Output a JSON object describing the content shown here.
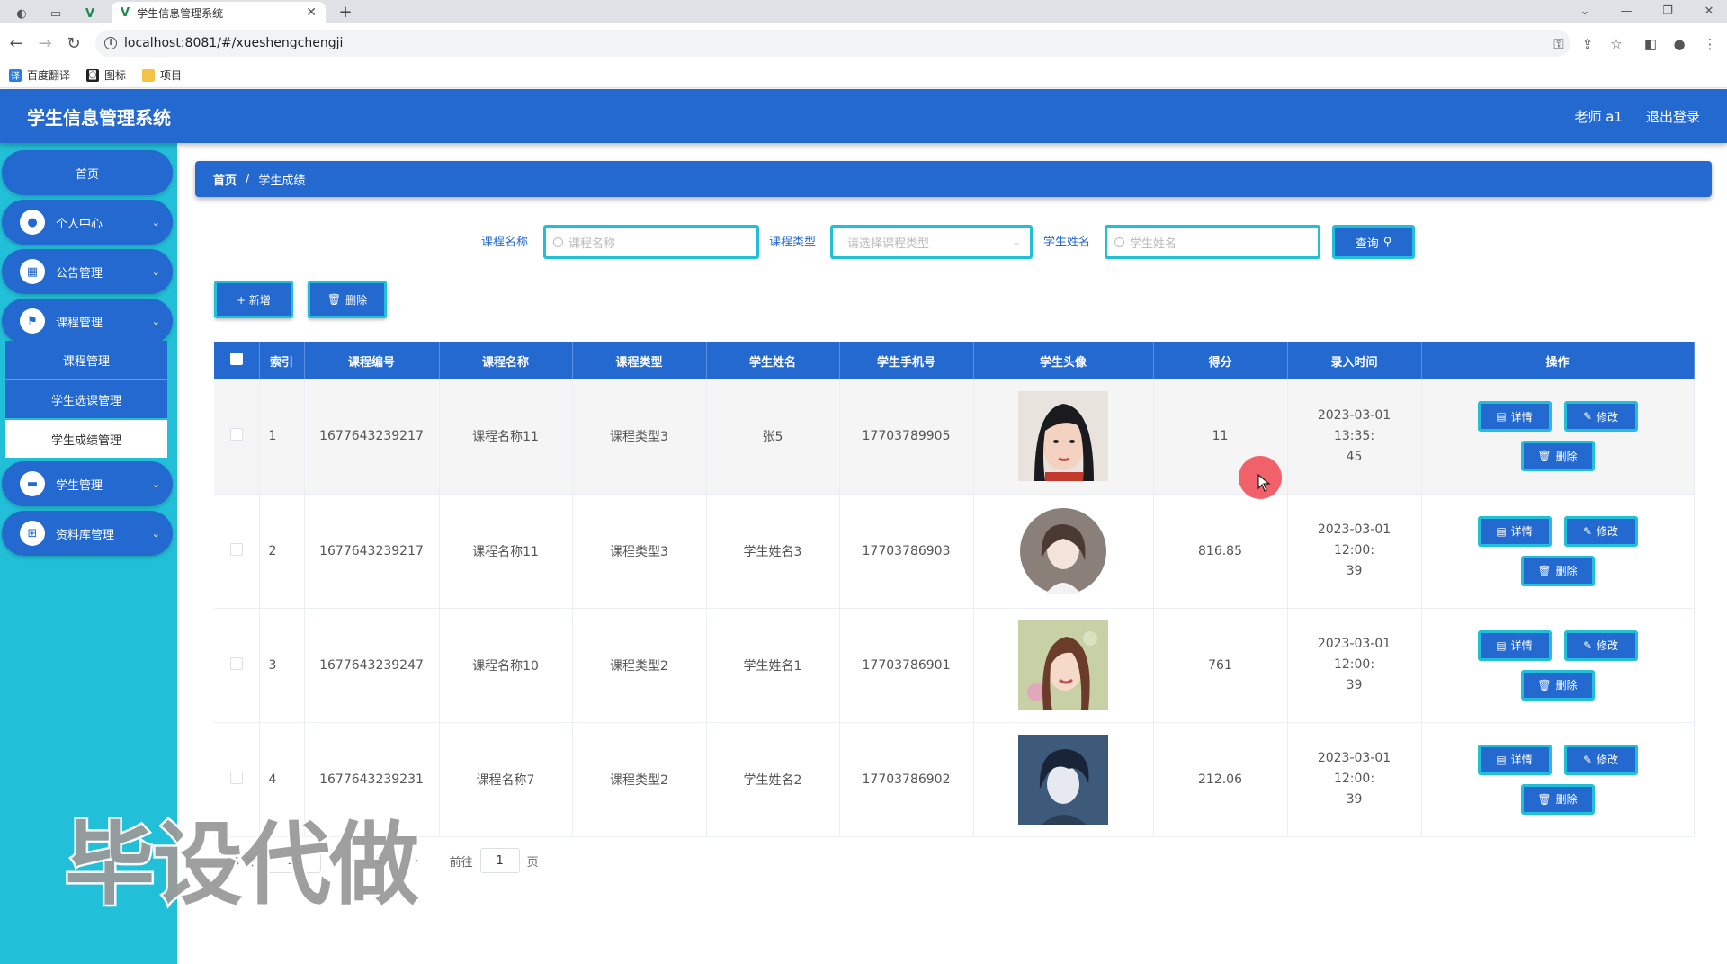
{
  "browser": {
    "tab_title": "学生信息管理系统",
    "url": "localhost:8081/#/xueshengchengji",
    "bookmarks": [
      {
        "label": "百度翻译",
        "color": "#2b7de9"
      },
      {
        "label": "图标",
        "color": "#222222"
      },
      {
        "label": "项目",
        "color": "#f3c246"
      }
    ]
  },
  "header": {
    "title": "学生信息管理系统",
    "user": "老师 a1",
    "logout": "退出登录"
  },
  "sidebar": {
    "home": "首页",
    "menus": [
      {
        "label": "个人中心",
        "icon": "user-icon"
      },
      {
        "label": "公告管理",
        "icon": "grid-icon"
      },
      {
        "label": "课程管理",
        "icon": "flag-icon"
      },
      {
        "label": "学生管理",
        "icon": "student-icon"
      },
      {
        "label": "资料库管理",
        "icon": "apps-icon"
      }
    ],
    "submenus": [
      "课程管理",
      "学生选课管理",
      "学生成绩管理"
    ]
  },
  "breadcrumb": {
    "home": "首页",
    "separator": "/",
    "current": "学生成绩"
  },
  "search": {
    "course_name_label": "课程名称",
    "course_name_placeholder": "课程名称",
    "course_type_label": "课程类型",
    "course_type_placeholder": "请选择课程类型",
    "student_name_label": "学生姓名",
    "student_name_placeholder": "学生姓名",
    "query_label": "查询"
  },
  "actions": {
    "add_label": "+ 新增",
    "delete_label": "删除"
  },
  "table": {
    "columns": [
      "索引",
      "课程编号",
      "课程名称",
      "课程类型",
      "学生姓名",
      "学生手机号",
      "学生头像",
      "得分",
      "录入时间",
      "操作"
    ],
    "rows": [
      {
        "index": "1",
        "code": "1677643239217",
        "course": "课程名称11",
        "type": "课程类型3",
        "student": "张5",
        "phone": "17703789905",
        "avatar": "avatar-1",
        "score": "11",
        "time1": "2023-03-01 13:35:",
        "time2": "45"
      },
      {
        "index": "2",
        "code": "1677643239217",
        "course": "课程名称11",
        "type": "课程类型3",
        "student": "学生姓名3",
        "phone": "17703786903",
        "avatar": "avatar-2",
        "score": "816.85",
        "time1": "2023-03-01 12:00:",
        "time2": "39"
      },
      {
        "index": "3",
        "code": "1677643239247",
        "course": "课程名称10",
        "type": "课程类型2",
        "student": "学生姓名1",
        "phone": "17703786901",
        "avatar": "avatar-3",
        "score": "761",
        "time1": "2023-03-01 12:00:",
        "time2": "39"
      },
      {
        "index": "4",
        "code": "1677643239231",
        "course": "课程名称7",
        "type": "课程类型2",
        "student": "学生姓名2",
        "phone": "17703786902",
        "avatar": "avatar-4",
        "score": "212.06",
        "time1": "2023-03-01 12:00:",
        "time2": "39"
      }
    ],
    "ops": {
      "detail": "详情",
      "edit": "修改",
      "delete": "删除"
    }
  },
  "pagination": {
    "total": "4 条",
    "page_size": "10",
    "current_page": "1",
    "goto_label": "前往",
    "goto_value": "1",
    "page_unit": "页"
  },
  "watermark": "毕设代做",
  "colors": {
    "primary": "#2469d0",
    "accent": "#21c0d8"
  }
}
